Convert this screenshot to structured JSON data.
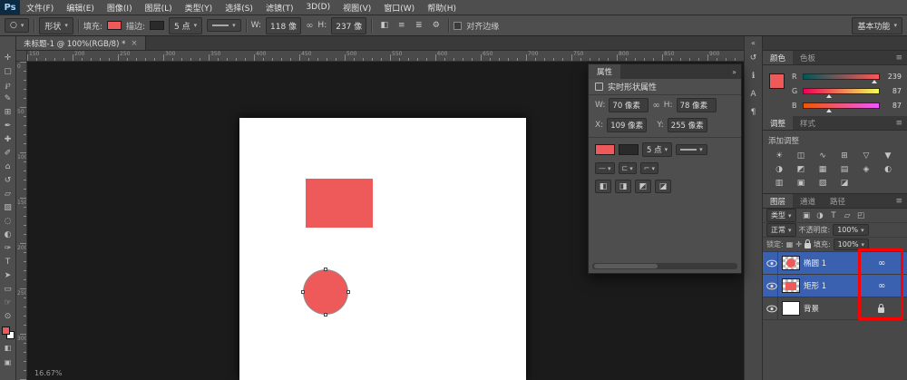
{
  "menu": {
    "logo": "Ps",
    "items": [
      {
        "name": "menu-file",
        "label": "文件(F)"
      },
      {
        "name": "menu-edit",
        "label": "编辑(E)"
      },
      {
        "name": "menu-image",
        "label": "图像(I)"
      },
      {
        "name": "menu-layer",
        "label": "图层(L)"
      },
      {
        "name": "menu-type",
        "label": "类型(Y)"
      },
      {
        "name": "menu-select",
        "label": "选择(S)"
      },
      {
        "name": "menu-filter",
        "label": "滤镜(T)"
      },
      {
        "name": "menu-3d",
        "label": "3D(D)"
      },
      {
        "name": "menu-view",
        "label": "视图(V)"
      },
      {
        "name": "menu-window",
        "label": "窗口(W)"
      },
      {
        "name": "menu-help",
        "label": "帮助(H)"
      }
    ]
  },
  "options": {
    "tool_mode": "形状",
    "fill_label": "填充:",
    "stroke_label": "描边:",
    "stroke_width": "5 点",
    "w_label": "W:",
    "w_value": "118 像",
    "h_label": "H:",
    "h_value": "237 像",
    "align_edges_label": "对齐边缘",
    "workspace": "基本功能",
    "tool_buttons": [
      {
        "name": "path-operations-button",
        "glyph": "◧"
      },
      {
        "name": "path-alignment-button",
        "glyph": "≡"
      },
      {
        "name": "path-arrange-button",
        "glyph": "≣"
      },
      {
        "name": "settings-gear-icon",
        "glyph": "⚙"
      }
    ]
  },
  "toolbar": {
    "tools": [
      {
        "name": "move-tool",
        "glyph": "✛"
      },
      {
        "name": "rectangular-marquee-tool",
        "glyph": "▢"
      },
      {
        "name": "lasso-tool",
        "glyph": "℘"
      },
      {
        "name": "quick-selection-tool",
        "glyph": "✎"
      },
      {
        "name": "crop-tool",
        "glyph": "⊞"
      },
      {
        "name": "eyedropper-tool",
        "glyph": "✒"
      },
      {
        "name": "healing-brush-tool",
        "glyph": "✚"
      },
      {
        "name": "brush-tool",
        "glyph": "✐"
      },
      {
        "name": "clone-stamp-tool",
        "glyph": "⌂"
      },
      {
        "name": "history-brush-tool",
        "glyph": "↺"
      },
      {
        "name": "eraser-tool",
        "glyph": "▱"
      },
      {
        "name": "gradient-tool",
        "glyph": "▨"
      },
      {
        "name": "blur-tool",
        "glyph": "◌"
      },
      {
        "name": "dodge-tool",
        "glyph": "◐"
      },
      {
        "name": "pen-tool",
        "glyph": "✑"
      },
      {
        "name": "type-tool",
        "glyph": "T"
      },
      {
        "name": "path-selection-tool",
        "glyph": "➤"
      },
      {
        "name": "rectangle-tool",
        "glyph": "▭"
      },
      {
        "name": "hand-tool",
        "glyph": "☞"
      },
      {
        "name": "zoom-tool",
        "glyph": "⊙"
      }
    ]
  },
  "document": {
    "tab_title": "未标题-1 @ 100%(RGB/8) *",
    "zoom_status": "16.67%"
  },
  "rulers": {
    "h_first_label": 150,
    "v_first_label": 0,
    "label_step": 50
  },
  "properties_panel": {
    "title": "属性",
    "collapse_icon": "»",
    "header": "实时形状属性",
    "w_label": "W:",
    "w_value": "70 像素",
    "h_label": "H:",
    "h_value": "78 像素",
    "x_label": "X:",
    "x_value": "109 像素",
    "y_label": "Y:",
    "y_value": "255 像素",
    "stroke_width": "5 点",
    "stroke_selects": [
      {
        "name": "stroke-align-select",
        "glyph": "—"
      },
      {
        "name": "stroke-cap-select",
        "glyph": "⊏"
      },
      {
        "name": "stroke-corner-select",
        "glyph": "⌐"
      }
    ],
    "pathops": [
      {
        "name": "combine-shapes-button",
        "glyph": "◧"
      },
      {
        "name": "subtract-shape-button",
        "glyph": "◨"
      },
      {
        "name": "intersect-shapes-button",
        "glyph": "◩"
      },
      {
        "name": "exclude-shapes-button",
        "glyph": "◪"
      }
    ]
  },
  "collapsed_panels": {
    "expand_icon": "«",
    "icons": [
      {
        "name": "history-panel-icon",
        "glyph": "↺"
      },
      {
        "name": "info-panel-icon",
        "glyph": "ℹ"
      },
      {
        "name": "character-panel-icon",
        "glyph": "A"
      },
      {
        "name": "paragraph-panel-icon",
        "glyph": "¶"
      }
    ]
  },
  "color_panel": {
    "tabs": [
      "颜色",
      "色板"
    ],
    "channels": [
      {
        "label": "R",
        "value": 239
      },
      {
        "label": "G",
        "value": 87
      },
      {
        "label": "B",
        "value": 87
      }
    ],
    "swatch": "#ee5a5a"
  },
  "adjustments_panel": {
    "tabs": [
      "调整",
      "样式"
    ],
    "add_label": "添加调整",
    "icons": [
      {
        "name": "brightness-contrast-icon",
        "glyph": "☀"
      },
      {
        "name": "levels-icon",
        "glyph": "◫"
      },
      {
        "name": "curves-icon",
        "glyph": "∿"
      },
      {
        "name": "exposure-icon",
        "glyph": "⊞"
      },
      {
        "name": "vibrance-icon",
        "glyph": "▽"
      },
      {
        "name": "hue-saturation-icon",
        "glyph": "▼"
      },
      {
        "name": "color-balance-icon",
        "glyph": "◑"
      },
      {
        "name": "black-white-icon",
        "glyph": "◩"
      },
      {
        "name": "photo-filter-icon",
        "glyph": "▦"
      },
      {
        "name": "channel-mixer-icon",
        "glyph": "▤"
      },
      {
        "name": "color-lookup-icon",
        "glyph": "◈"
      },
      {
        "name": "invert-icon",
        "glyph": "◐"
      },
      {
        "name": "posterize-icon",
        "glyph": "▥"
      },
      {
        "name": "threshold-icon",
        "glyph": "▣"
      },
      {
        "name": "gradient-map-icon",
        "glyph": "▧"
      },
      {
        "name": "selective-color-icon",
        "glyph": "◪"
      }
    ]
  },
  "layers_panel": {
    "tabs": [
      "图层",
      "通道",
      "路径"
    ],
    "filter_label": "类型",
    "filter_icons": [
      {
        "name": "filter-pixel-icon",
        "glyph": "▣"
      },
      {
        "name": "filter-adjustment-icon",
        "glyph": "◑"
      },
      {
        "name": "filter-type-icon",
        "glyph": "T"
      },
      {
        "name": "filter-shape-icon",
        "glyph": "▱"
      },
      {
        "name": "filter-smartobject-icon",
        "glyph": "◰"
      }
    ],
    "blend_mode": "正常",
    "opacity_label": "不透明度:",
    "opacity_value": "100%",
    "lock_label": "锁定:",
    "lock_icons": [
      {
        "name": "lock-transparent-icon",
        "glyph": "▦"
      },
      {
        "name": "lock-position-icon",
        "glyph": "✛"
      }
    ],
    "fill_label": "填充:",
    "fill_value": "100%",
    "rows": [
      {
        "name": "椭圆 1"
      },
      {
        "name": "矩形 1"
      },
      {
        "name": "背景"
      }
    ]
  },
  "colors": {
    "accent": "#ee5a5a",
    "selection": "#3a60b0",
    "annotation": "#ff0000"
  },
  "icons": {
    "caret": "▾",
    "link": "∞",
    "chain": "∞",
    "close": "×",
    "panel_menu": "≡",
    "ellipse_tool": "○",
    "quick_mask": "◧",
    "screen_mode": "▣"
  }
}
